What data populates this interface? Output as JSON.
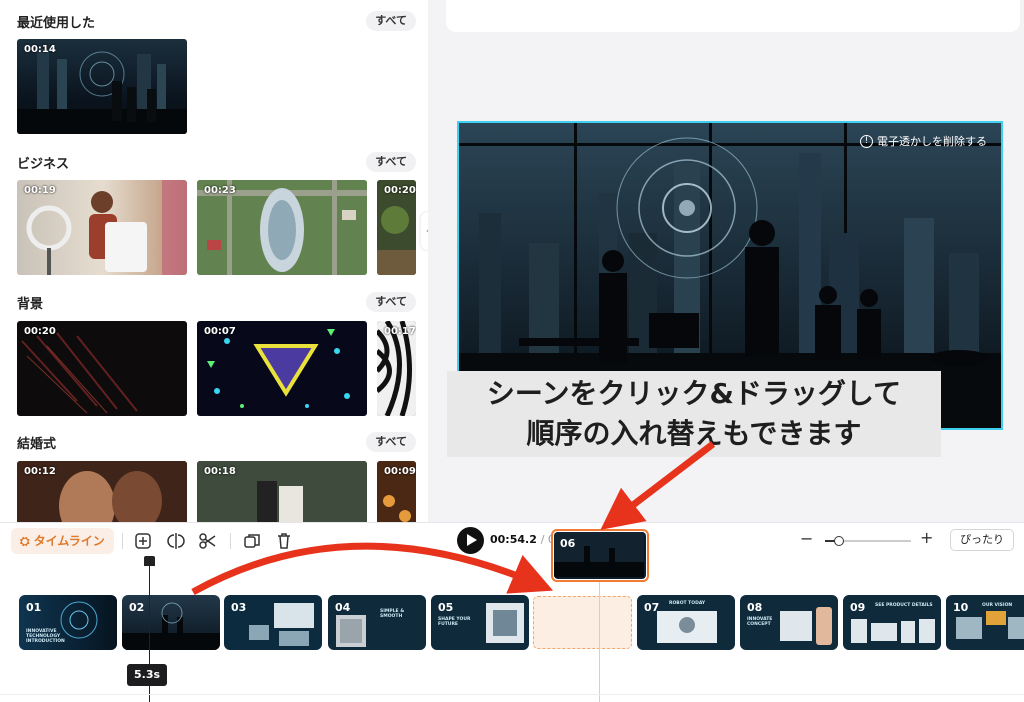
{
  "panel": {
    "see_all": "すべて",
    "sections": [
      {
        "title": "最近使用した",
        "thumbs": [
          "00:14"
        ]
      },
      {
        "title": "ビジネス",
        "thumbs": [
          "00:19",
          "00:23",
          "00:20"
        ]
      },
      {
        "title": "背景",
        "thumbs": [
          "00:20",
          "00:07",
          "00:17"
        ]
      },
      {
        "title": "結婚式",
        "thumbs": [
          "00:12",
          "00:18",
          "00:09"
        ]
      }
    ]
  },
  "preview": {
    "remove_watermark": "電子透かしを削除する"
  },
  "annotation": {
    "line1": "シーンをクリック&ドラッグして",
    "line2": "順序の入れ替えもできます"
  },
  "toolbar": {
    "timeline_label": "タイムライン",
    "current_time": "00:54.2",
    "total_time": "/ 01",
    "fit_label": "ぴったり"
  },
  "timeline": {
    "playhead_duration": "5.3s",
    "dragging_clip": "06",
    "clips": [
      {
        "num": "01",
        "caption": "INNOVATIVE TECHNOLOGY INTRODUCTION"
      },
      {
        "num": "02",
        "caption": ""
      },
      {
        "num": "03",
        "caption": ""
      },
      {
        "num": "04",
        "caption": "SIMPLE & SMOOTH"
      },
      {
        "num": "05",
        "caption": "SHAPE YOUR FUTURE"
      },
      {
        "num": "07",
        "caption": "ROBOT TODAY"
      },
      {
        "num": "08",
        "caption": "INNOVATE CONCEPT"
      },
      {
        "num": "09",
        "caption": "SEE PRODUCT DETAILS"
      },
      {
        "num": "10",
        "caption": "OUR VISION"
      }
    ]
  },
  "colors": {
    "accent": "#f07b36",
    "selection": "#3fd0f0",
    "arrow": "#e8331c"
  }
}
